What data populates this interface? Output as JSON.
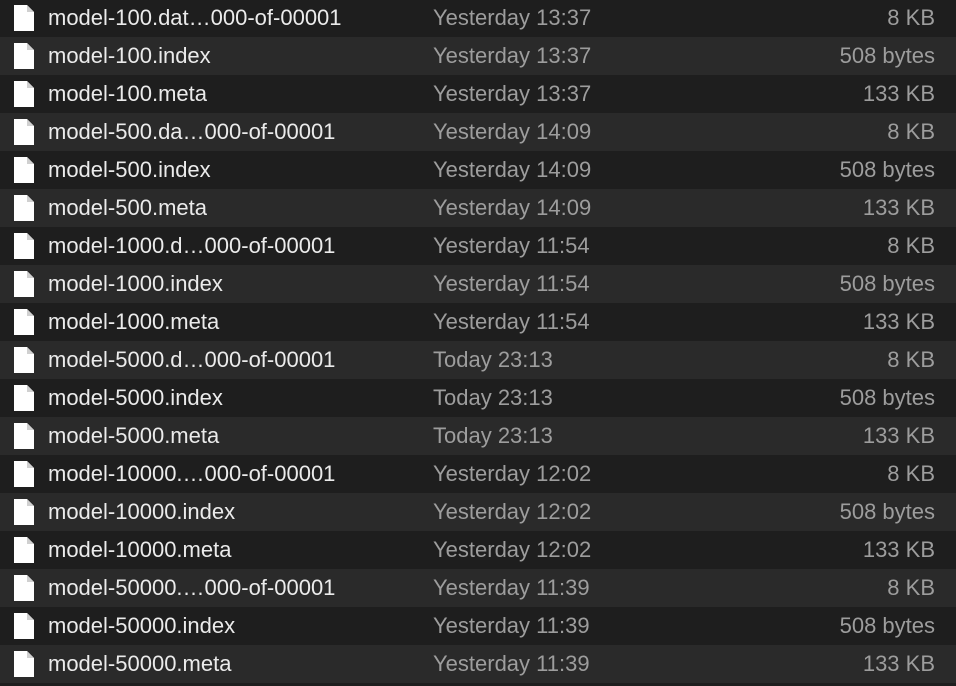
{
  "colors": {
    "row_even": "#1e1e1e",
    "row_odd": "#2a2a2a",
    "name_text": "#ebebeb",
    "meta_text": "#9d9d9d",
    "icon_fill": "#ffffff"
  },
  "icon": "document-icon",
  "files": [
    {
      "name": "model-100.dat…000-of-00001",
      "date": "Yesterday 13:37",
      "size": "8 KB"
    },
    {
      "name": "model-100.index",
      "date": "Yesterday 13:37",
      "size": "508 bytes"
    },
    {
      "name": "model-100.meta",
      "date": "Yesterday 13:37",
      "size": "133 KB"
    },
    {
      "name": "model-500.da…000-of-00001",
      "date": "Yesterday 14:09",
      "size": "8 KB"
    },
    {
      "name": "model-500.index",
      "date": "Yesterday 14:09",
      "size": "508 bytes"
    },
    {
      "name": "model-500.meta",
      "date": "Yesterday 14:09",
      "size": "133 KB"
    },
    {
      "name": "model-1000.d…000-of-00001",
      "date": "Yesterday 11:54",
      "size": "8 KB"
    },
    {
      "name": "model-1000.index",
      "date": "Yesterday 11:54",
      "size": "508 bytes"
    },
    {
      "name": "model-1000.meta",
      "date": "Yesterday 11:54",
      "size": "133 KB"
    },
    {
      "name": "model-5000.d…000-of-00001",
      "date": "Today 23:13",
      "size": "8 KB"
    },
    {
      "name": "model-5000.index",
      "date": "Today 23:13",
      "size": "508 bytes"
    },
    {
      "name": "model-5000.meta",
      "date": "Today 23:13",
      "size": "133 KB"
    },
    {
      "name": "model-10000.…000-of-00001",
      "date": "Yesterday 12:02",
      "size": "8 KB"
    },
    {
      "name": "model-10000.index",
      "date": "Yesterday 12:02",
      "size": "508 bytes"
    },
    {
      "name": "model-10000.meta",
      "date": "Yesterday 12:02",
      "size": "133 KB"
    },
    {
      "name": "model-50000.…000-of-00001",
      "date": "Yesterday 11:39",
      "size": "8 KB"
    },
    {
      "name": "model-50000.index",
      "date": "Yesterday 11:39",
      "size": "508 bytes"
    },
    {
      "name": "model-50000.meta",
      "date": "Yesterday 11:39",
      "size": "133 KB"
    }
  ]
}
